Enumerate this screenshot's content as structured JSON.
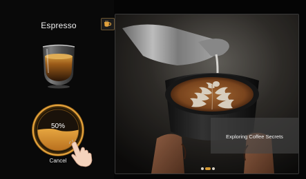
{
  "drink": {
    "name": "Espresso"
  },
  "brewing": {
    "progress_percent": 50,
    "progress_label": "50%",
    "cancel_label": "Cancel"
  },
  "media": {
    "caption": "Exploring Coffee Secrets",
    "slides_total": 3,
    "active_slide_index": 1
  },
  "colors": {
    "background": "#050505",
    "accent": "#E3A23C",
    "coffee_fill": "#C9832A",
    "caption_overlay": "#464646"
  },
  "icons": {
    "mode_icon": "coffee-cup-icon",
    "gesture_icon": "tapping-hand-icon"
  }
}
